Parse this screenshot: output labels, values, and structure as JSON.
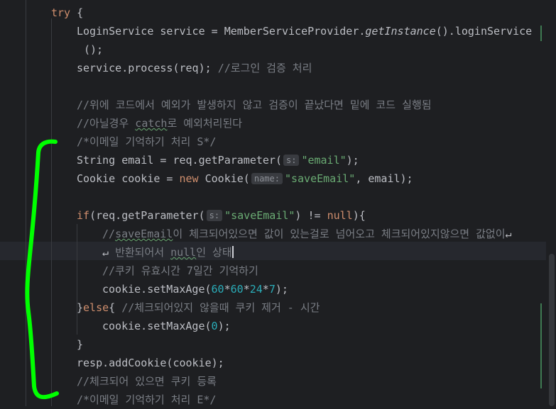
{
  "editor": {
    "lines": [
      {
        "segments": [
          {
            "t": "try",
            "c": "kw"
          },
          {
            "t": " {",
            "c": ""
          }
        ]
      },
      {
        "segments": [
          {
            "t": "LoginService service = MemberServiceProvider.",
            "c": ""
          },
          {
            "t": "getInstance",
            "c": "ital"
          },
          {
            "t": "().loginService",
            "c": ""
          }
        ]
      },
      {
        "segments": [
          {
            "t": "();",
            "c": ""
          }
        ]
      },
      {
        "segments": [
          {
            "t": "service.process(req); ",
            "c": ""
          },
          {
            "t": "//로그인 검증 처리",
            "c": "cm"
          }
        ]
      },
      {
        "segments": []
      },
      {
        "segments": [
          {
            "t": "//위에 코드에서 예외가 발생하지 않고 검증이 끝났다면 밑에 코드 실행됨",
            "c": "cm"
          }
        ]
      },
      {
        "segments": [
          {
            "t": "//아닐경우 ",
            "c": "cm"
          },
          {
            "t": "catch",
            "c": "cm squig"
          },
          {
            "t": "로 예외처리된다",
            "c": "cm"
          }
        ]
      },
      {
        "segments": [
          {
            "t": "/*이메일 기억하기 처리 S*/",
            "c": "cm"
          }
        ]
      },
      {
        "segments": [
          {
            "t": "String email = req.getParameter(",
            "c": ""
          },
          {
            "hint": "s:"
          },
          {
            "t": "\"email\"",
            "c": "str"
          },
          {
            "t": ");",
            "c": ""
          }
        ]
      },
      {
        "segments": [
          {
            "t": "Cookie cookie = ",
            "c": ""
          },
          {
            "t": "new",
            "c": "kw"
          },
          {
            "t": " Cookie(",
            "c": ""
          },
          {
            "hint": "name:"
          },
          {
            "t": "\"saveEmail\"",
            "c": "str"
          },
          {
            "t": ", email);",
            "c": ""
          }
        ]
      },
      {
        "segments": []
      },
      {
        "segments": [
          {
            "t": "if",
            "c": "kw"
          },
          {
            "t": "(req.getParameter(",
            "c": ""
          },
          {
            "hint": "s:"
          },
          {
            "t": "\"saveEmail\"",
            "c": "str"
          },
          {
            "t": ") != ",
            "c": ""
          },
          {
            "t": "null",
            "c": "kw"
          },
          {
            "t": "){",
            "c": ""
          }
        ]
      },
      {
        "segments": [
          {
            "t": "//",
            "c": "cm"
          },
          {
            "t": "saveEmail",
            "c": "cm squig"
          },
          {
            "t": "이 체크되어있으면 값이 있는걸로 넘어오고 체크되어있지않으면 값없이",
            "c": "cm"
          }
        ]
      },
      {
        "segments": [
          {
            "t": "반환되어서 ",
            "c": "cm"
          },
          {
            "t": "null",
            "c": "cm squig"
          },
          {
            "t": "인 상태",
            "c": "cm"
          }
        ]
      },
      {
        "segments": [
          {
            "t": "//쿠키 유효시간 7일간 기억하기",
            "c": "cm"
          }
        ]
      },
      {
        "segments": [
          {
            "t": "cookie.setMaxAge(",
            "c": ""
          },
          {
            "t": "60",
            "c": "num"
          },
          {
            "t": "*",
            "c": ""
          },
          {
            "t": "60",
            "c": "num"
          },
          {
            "t": "*",
            "c": ""
          },
          {
            "t": "24",
            "c": "num"
          },
          {
            "t": "*",
            "c": ""
          },
          {
            "t": "7",
            "c": "num"
          },
          {
            "t": ");",
            "c": ""
          }
        ]
      },
      {
        "segments": [
          {
            "t": "}",
            "c": ""
          },
          {
            "t": "else",
            "c": "kw"
          },
          {
            "t": "{ ",
            "c": ""
          },
          {
            "t": "//체크되어있지 않을때 쿠키 제거 - 시간",
            "c": "cm"
          }
        ]
      },
      {
        "segments": [
          {
            "t": "cookie.setMaxAge(",
            "c": ""
          },
          {
            "t": "0",
            "c": "num"
          },
          {
            "t": ");",
            "c": ""
          }
        ]
      },
      {
        "segments": [
          {
            "t": "}",
            "c": ""
          }
        ]
      },
      {
        "segments": [
          {
            "t": "resp.addCookie(cookie);",
            "c": ""
          }
        ]
      },
      {
        "segments": [
          {
            "t": "//체크되어 있으면 쿠키 등록",
            "c": "cm"
          }
        ]
      },
      {
        "segments": [
          {
            "t": "/*이메일 기억하기 처리 E*/",
            "c": "cm"
          }
        ]
      }
    ],
    "wrap_glyph": "↵",
    "annotation_color": "#00ff00"
  }
}
